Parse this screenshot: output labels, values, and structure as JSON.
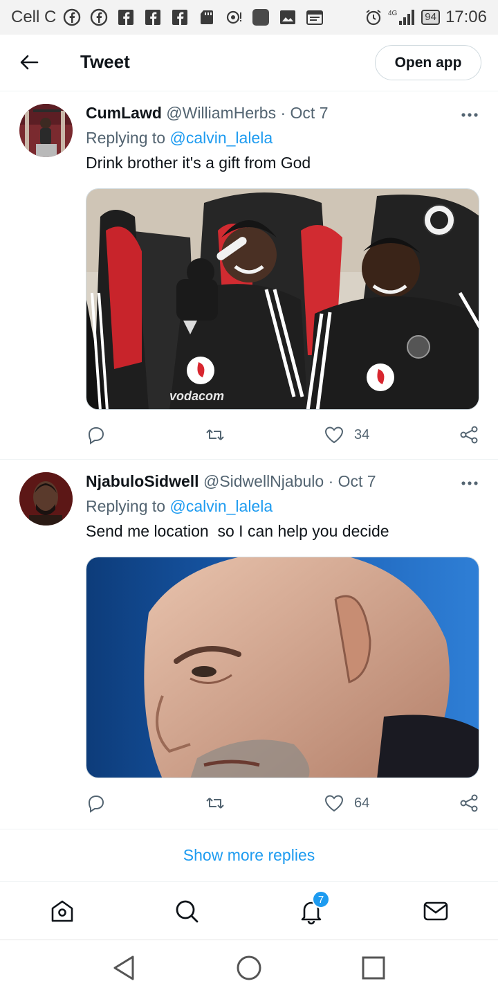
{
  "status_bar": {
    "carrier": "Cell C",
    "network": "4G",
    "battery": "94",
    "time": "17:06"
  },
  "header": {
    "back_icon": "arrow-left-icon",
    "title": "Tweet",
    "open_app_label": "Open app"
  },
  "tweets": [
    {
      "name": "CumLawd",
      "handle": "@WilliamHerbs",
      "separator": "·",
      "date": "Oct 7",
      "replying_prefix": "Replying to",
      "replying_to": "@calvin_lalela",
      "text": "Drink brother it's a gift from God",
      "likes": "34",
      "media_text": "vodacom"
    },
    {
      "name": "NjabuloSidwell",
      "handle": "@SidwellNjabulo",
      "separator": "·",
      "date": "Oct 7",
      "replying_prefix": "Replying to",
      "replying_to": "@calvin_lalela",
      "text": "Send me location  so I can help you decide",
      "likes": "64"
    }
  ],
  "show_more_label": "Show more replies",
  "bottom_nav": {
    "items": [
      "home-icon",
      "search-icon",
      "bell-icon",
      "mail-icon"
    ],
    "notification_count": "7"
  },
  "colors": {
    "accent": "#1d9bf0",
    "secondary_text": "#536471",
    "primary_text": "#0f1419"
  }
}
